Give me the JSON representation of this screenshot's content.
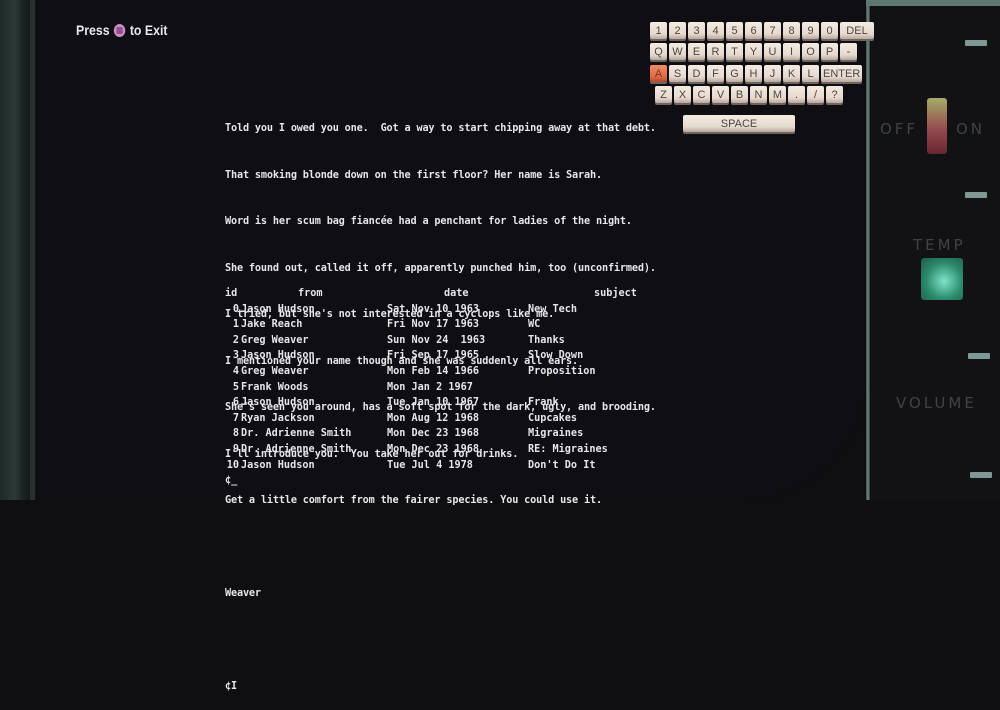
{
  "hud": {
    "exit_prefix": "Press",
    "exit_button_icon": "square-button",
    "exit_suffix": "to Exit"
  },
  "terminal": {
    "message_lines": [
      "Told you I owed you one.  Got a way to start chipping away at that debt.",
      "That smoking blonde down on the first floor? Her name is Sarah.",
      "Word is her scum bag fiancée had a penchant for ladies of the night.",
      "She found out, called it off, apparently punched him, too (unconfirmed).",
      "I tried, but she's not interested in a cyclops like me.",
      "I mentioned your name though and she was suddenly all ears.",
      "She's seen you around, has a soft spot for the dark, ugly, and brooding.",
      "I'll introduce you.  You take her out for drinks.",
      "Get a little comfort from the fairer species. You could use it."
    ],
    "signature": "Weaver",
    "command": "¢I",
    "prompt": "¢_",
    "mail_headers": {
      "id": "id",
      "from": "from",
      "date": "date",
      "subject": "subject"
    },
    "mail": [
      {
        "id": "0",
        "from": "Jason Hudson",
        "date": "Sat Nov 10 1963",
        "subject": "New Tech"
      },
      {
        "id": "1",
        "from": "Jake Reach",
        "date": "Fri Nov 17 1963",
        "subject": "WC"
      },
      {
        "id": "2",
        "from": "Greg Weaver",
        "date": "Sun Nov 24  1963",
        "subject": "Thanks"
      },
      {
        "id": "3",
        "from": "Jason Hudson",
        "date": "Fri Sep 17 1965",
        "subject": "Slow Down"
      },
      {
        "id": "4",
        "from": "Greg Weaver",
        "date": "Mon Feb 14 1966",
        "subject": "Proposition"
      },
      {
        "id": "5",
        "from": "Frank Woods",
        "date": "Mon Jan 2 1967",
        "subject": ""
      },
      {
        "id": "6",
        "from": "Jason Hudson",
        "date": "Tue Jan 10 1967",
        "subject": "Frank"
      },
      {
        "id": "7",
        "from": "Ryan Jackson",
        "date": "Mon Aug 12 1968",
        "subject": "Cupcakes"
      },
      {
        "id": "8",
        "from": "Dr. Adrienne Smith",
        "date": "Mon Dec 23 1968",
        "subject": "Migraines"
      },
      {
        "id": "9",
        "from": "Dr. Adrienne Smith",
        "date": "Mon Dec 23 1968",
        "subject": "RE: Migraines"
      },
      {
        "id": "10",
        "from": "Jason Hudson",
        "date": "Tue Jul 4 1978",
        "subject": "Don't Do It"
      }
    ]
  },
  "keyboard": {
    "selected_key": "A",
    "rows": [
      [
        "1",
        "2",
        "3",
        "4",
        "5",
        "6",
        "7",
        "8",
        "9",
        "0",
        "DEL"
      ],
      [
        "Q",
        "W",
        "E",
        "R",
        "T",
        "Y",
        "U",
        "I",
        "O",
        "P",
        "-"
      ],
      [
        "A",
        "S",
        "D",
        "F",
        "G",
        "H",
        "J",
        "K",
        "L",
        "ENTER"
      ],
      [
        "Z",
        "X",
        "C",
        "V",
        "B",
        "N",
        "M",
        ".",
        "/",
        "?"
      ],
      [
        "SPACE"
      ]
    ]
  },
  "panel": {
    "power_off_label": "OFF",
    "power_on_label": "ON",
    "temp_label": "TEMP",
    "volume_label": "VOLUME"
  }
}
